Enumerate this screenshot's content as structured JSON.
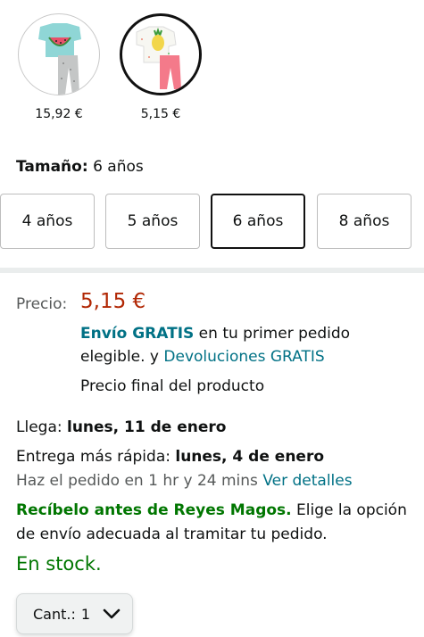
{
  "swatches": [
    {
      "name": "watermelon-pajama",
      "price": "15,92 €",
      "selected": false
    },
    {
      "name": "pineapple-pajama",
      "price": "5,15 €",
      "selected": true
    }
  ],
  "size": {
    "label": "Tamaño:",
    "value": "6 años",
    "options": [
      "4 años",
      "5 años",
      "6 años",
      "8 años"
    ],
    "selected": "6 años"
  },
  "price": {
    "label": "Precio:",
    "value": "5,15 €",
    "shipping_free": "Envío GRATIS",
    "shipping_rest": " en tu primer pedido",
    "shipping_line2": "elegible. y ",
    "returns_link": "Devoluciones GRATIS",
    "final_note": "Precio final del producto"
  },
  "delivery": {
    "arrives_label": "Llega: ",
    "arrives_date": "lunes, 11 de enero",
    "fastest_label": "Entrega más rápida: ",
    "fastest_date": "lunes, 4 de enero",
    "order_within": "Haz el pedido en 1 hr y 24 mins ",
    "details_link": "Ver detalles",
    "promo_bold": "Recíbelo antes de Reyes Magos.",
    "promo_rest": " Elige la opción",
    "promo_line2": "de envío adecuada al tramitar tu pedido."
  },
  "stock": "En stock.",
  "quantity": {
    "label": "Cant.:",
    "value": "1"
  },
  "colors": {
    "price_red": "#b12704",
    "link_teal": "#007185",
    "success_green": "#007600"
  }
}
